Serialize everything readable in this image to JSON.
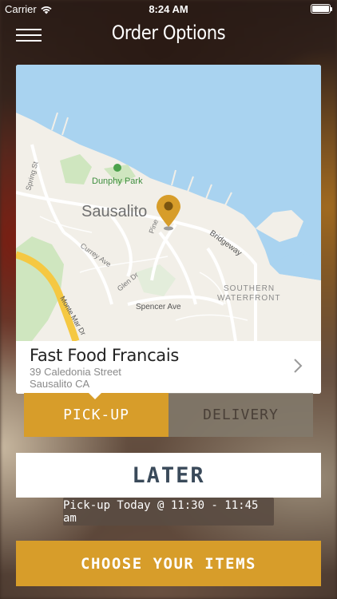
{
  "status_bar": {
    "carrier": "Carrier",
    "time": "8:24 AM",
    "wifi_icon": "wifi-icon",
    "battery_icon": "battery-icon"
  },
  "header": {
    "title": "Order Options",
    "menu_icon": "hamburger-menu-icon"
  },
  "map": {
    "labels": {
      "park": "Dunphy Park",
      "town": "Sausalito",
      "bridgeway": "Bridgeway",
      "pine": "Pine",
      "spring": "Spring St",
      "currey": "Currey Ave",
      "glen": "Glen Dr",
      "spencer": "Spencer Ave",
      "monte_mar": "Monte Mar Dr",
      "southern_1": "SOUTHERN",
      "southern_2": "WATERFRONT"
    }
  },
  "restaurant": {
    "name": "Fast Food Francais",
    "street": "39 Caledonia Street",
    "city": "Sausalito CA"
  },
  "tabs": {
    "pickup": "PICK-UP",
    "delivery": "DELIVERY",
    "active": "pickup"
  },
  "later_button": "LATER",
  "pickup_time": "Pick-up Today @ 11:30 - 11:45 am",
  "choose_button": "CHOOSE YOUR ITEMS",
  "colors": {
    "accent": "#d79d2a",
    "water": "#a9d3f0",
    "land": "#f2efe8",
    "park": "#cfe6bf",
    "highway": "#f5c842"
  }
}
